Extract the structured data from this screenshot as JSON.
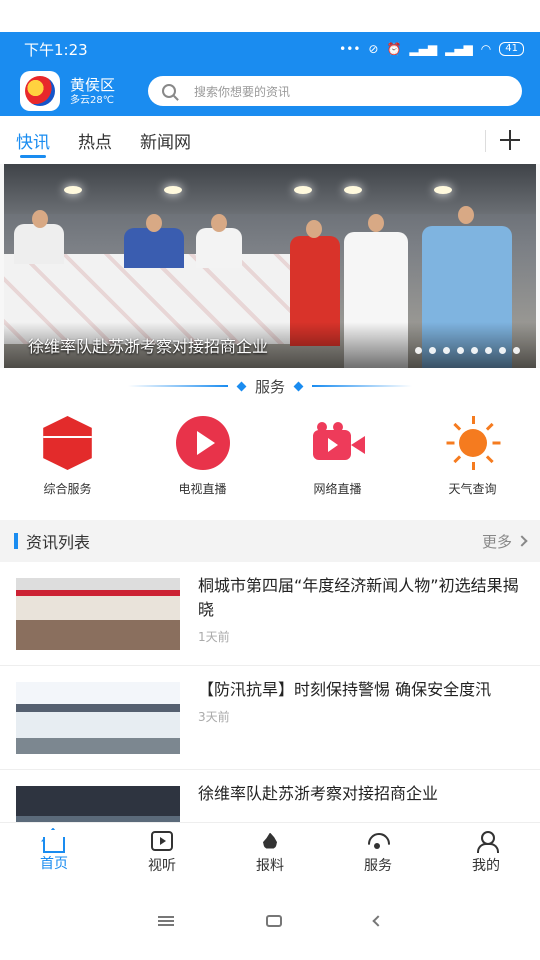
{
  "status_bar": {
    "time": "下午1:23",
    "battery": "41"
  },
  "header": {
    "district": "黄侯区",
    "weather": "多云28℃",
    "search_placeholder": "搜索你想要的资讯"
  },
  "tabs": [
    {
      "label": "快讯",
      "active": true
    },
    {
      "label": "热点",
      "active": false
    },
    {
      "label": "新闻网",
      "active": false
    }
  ],
  "banner": {
    "caption": "徐维率队赴苏浙考察对接招商企业",
    "dot_count": 8
  },
  "services": {
    "title": "服务",
    "items": [
      {
        "label": "综合服务",
        "icon": "cube-icon"
      },
      {
        "label": "电视直播",
        "icon": "play-circle-icon"
      },
      {
        "label": "网络直播",
        "icon": "video-camera-icon"
      },
      {
        "label": "天气查询",
        "icon": "sun-icon"
      }
    ]
  },
  "news_section": {
    "title": "资讯列表",
    "more": "更多"
  },
  "news": [
    {
      "title": "桐城市第四届“年度经济新闻人物”初选结果揭晓",
      "time": "1天前"
    },
    {
      "title": "【防汛抗旱】时刻保持警惕 确保安全度汛",
      "time": "3天前"
    },
    {
      "title": "徐维率队赴苏浙考察对接招商企业",
      "time": ""
    }
  ],
  "bottom_nav": [
    {
      "label": "首页",
      "icon": "home-icon",
      "active": true
    },
    {
      "label": "视听",
      "icon": "tv-icon",
      "active": false
    },
    {
      "label": "报料",
      "icon": "fire-icon",
      "active": false
    },
    {
      "label": "服务",
      "icon": "service-icon",
      "active": false
    },
    {
      "label": "我的",
      "icon": "user-icon",
      "active": false
    }
  ],
  "colors": {
    "accent": "#1a8cf0",
    "red": "#e32b2b",
    "orange": "#f57b1f"
  }
}
